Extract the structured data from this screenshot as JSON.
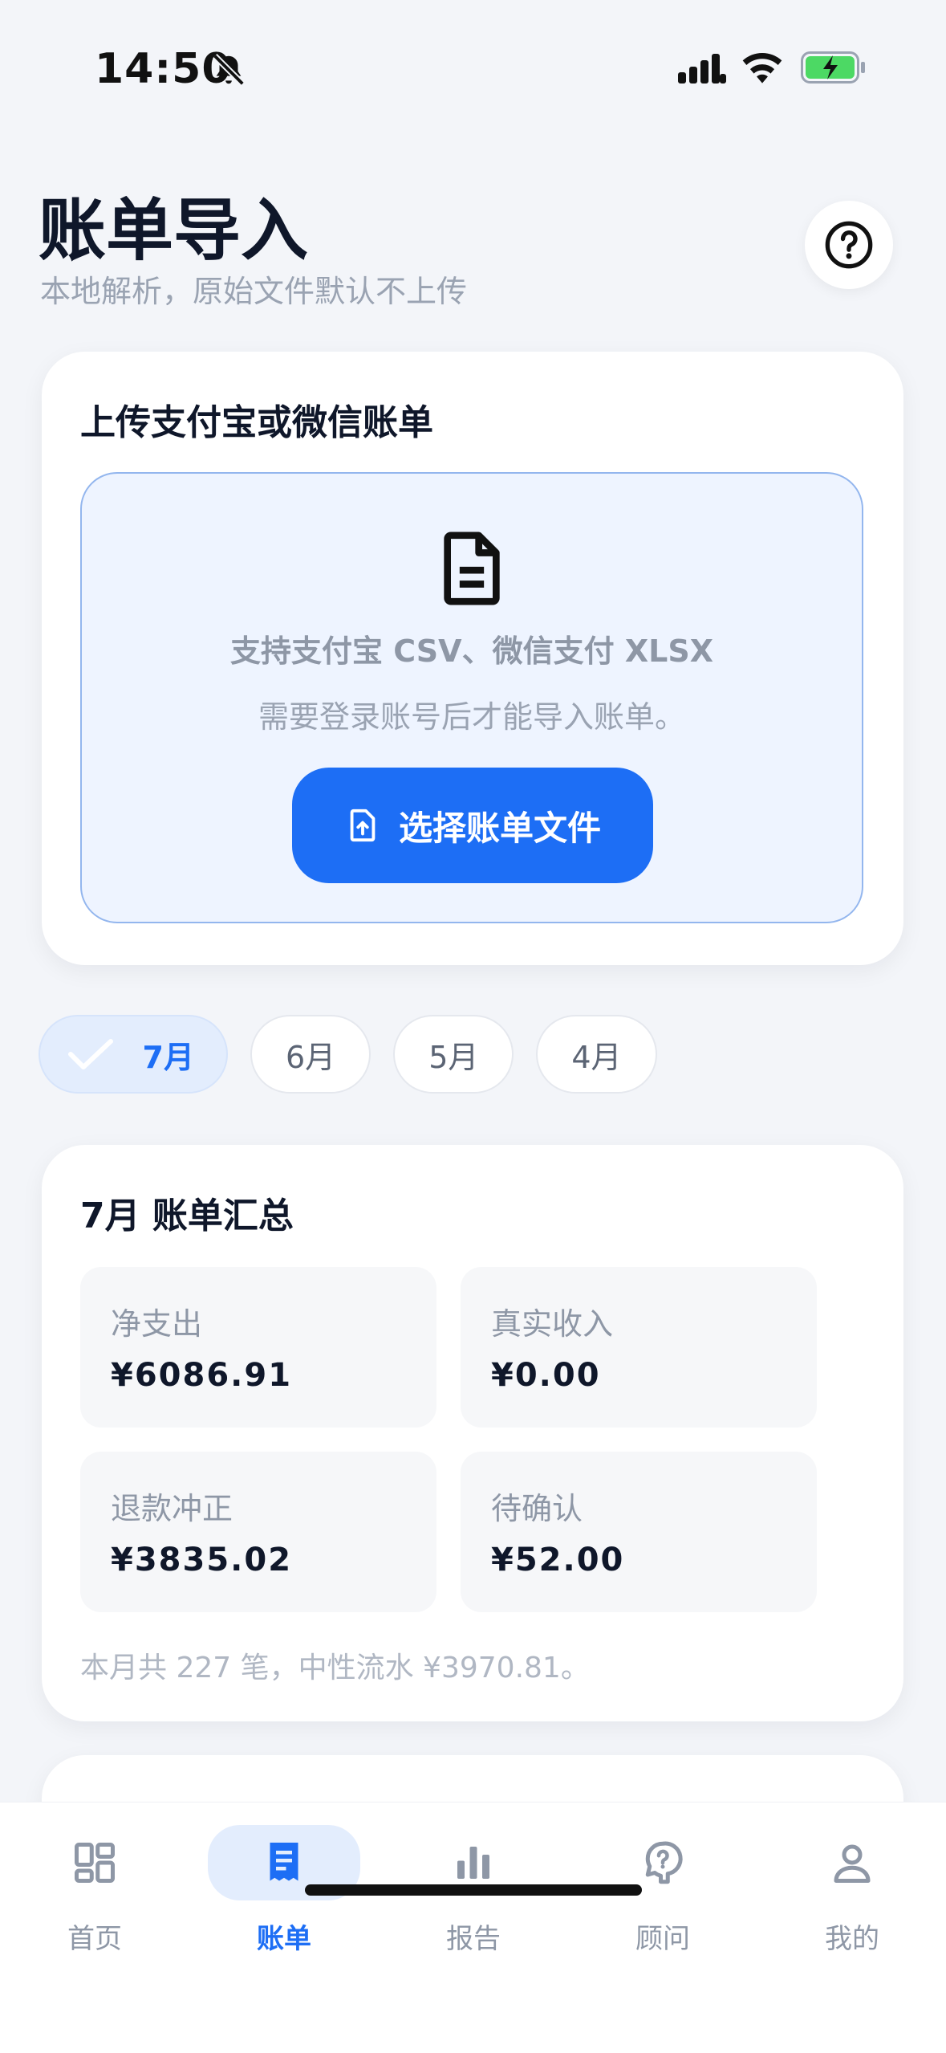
{
  "status_bar": {
    "time": "14:50"
  },
  "header": {
    "title": "账单导入",
    "subtitle": "本地解析，原始文件默认不上传"
  },
  "upload": {
    "title": "上传支付宝或微信账单",
    "formats": "支持支付宝 CSV、微信支付 XLSX",
    "hint": "需要登录账号后才能导入账单。",
    "button_label": "选择账单文件"
  },
  "months": [
    {
      "label": "7月",
      "selected": true
    },
    {
      "label": "6月",
      "selected": false
    },
    {
      "label": "5月",
      "selected": false
    },
    {
      "label": "4月",
      "selected": false
    }
  ],
  "summary": {
    "title": "7月 账单汇总",
    "stats": [
      {
        "label": "净支出",
        "value": "¥6086.91"
      },
      {
        "label": "真实收入",
        "value": "¥0.00"
      },
      {
        "label": "退款冲正",
        "value": "¥3835.02"
      },
      {
        "label": "待确认",
        "value": "¥52.00"
      }
    ],
    "note": "本月共 227 笔，中性流水 ¥3970.81。"
  },
  "tab_bar": {
    "items": [
      {
        "label": "首页",
        "icon": "dashboard-icon"
      },
      {
        "label": "账单",
        "icon": "receipt-icon",
        "active": true
      },
      {
        "label": "报告",
        "icon": "bar-chart-icon"
      },
      {
        "label": "顾问",
        "icon": "advisor-icon"
      },
      {
        "label": "我的",
        "icon": "profile-icon"
      }
    ]
  },
  "colors": {
    "accent": "#1d6ef5",
    "accent_soft": "#e3edfd",
    "background": "#f3f5f9"
  }
}
